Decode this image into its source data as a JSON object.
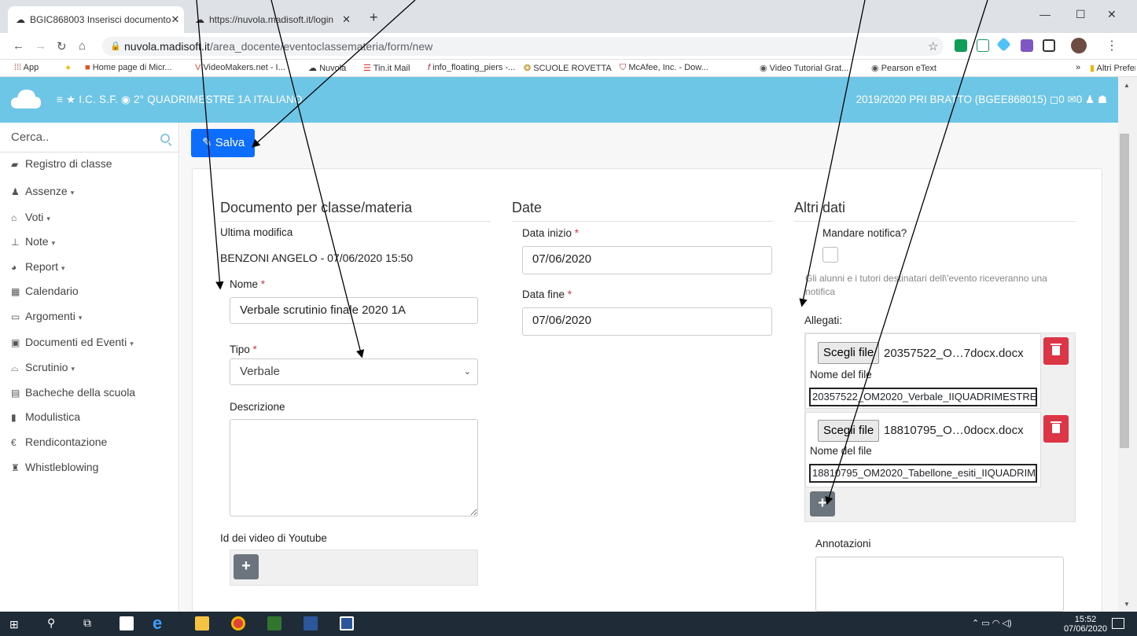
{
  "browser": {
    "tabs": [
      {
        "label": "BGIC868003 Inserisci documento",
        "close": "✕"
      },
      {
        "label": "https://nuvola.madisoft.it/login",
        "close": "✕"
      }
    ],
    "new_tab": "+",
    "window_controls": [
      "—",
      "☐",
      "✕"
    ],
    "url_host": "nuvola.madisoft.it",
    "url_path": "/area_docente/eventoclassemateria/form/new",
    "bookmarks": [
      "App",
      "Home page di Micr...",
      "VideoMakers.net - I...",
      "Nuvola",
      "Tin.it Mail",
      "info_floating_piers -...",
      "SCUOLE ROVETTA",
      "McAfee, Inc. - Dow...",
      "Video Tutorial Grat...",
      "Pearson eText"
    ],
    "bookmarks_more": "»",
    "other_bookmarks": "Altri Preferiti"
  },
  "header": {
    "left": "≡ ★ I.C. S.F. ◉ 2° QUADRIMESTRE  1A  ITALIANO",
    "right": "2019/2020  PRI BRATTO (BGEE868015) ◻0 ✉0 ♟ ☗"
  },
  "sidebar": {
    "search_placeholder": "Cerca..",
    "items": [
      {
        "label": "Registro di classe",
        "caret": ""
      },
      {
        "label": "Assenze",
        "caret": "▾"
      },
      {
        "label": "Voti",
        "caret": "▾"
      },
      {
        "label": "Note",
        "caret": "▾"
      },
      {
        "label": "Report",
        "caret": "▾"
      },
      {
        "label": "Calendario",
        "caret": ""
      },
      {
        "label": "Argomenti",
        "caret": "▾"
      },
      {
        "label": "Documenti ed Eventi",
        "caret": "▾"
      },
      {
        "label": "Scrutinio",
        "caret": "▾"
      },
      {
        "label": "Bacheche della scuola",
        "caret": ""
      },
      {
        "label": "Modulistica",
        "caret": ""
      },
      {
        "label": "Rendicontazione",
        "caret": ""
      },
      {
        "label": "Whistleblowing",
        "caret": ""
      }
    ]
  },
  "toolbar": {
    "save_label": "Salva"
  },
  "form": {
    "col1": {
      "title": "Documento per classe/materia",
      "last_modified_label": "Ultima modifica",
      "last_modified_value": "BENZONI ANGELO - 07/06/2020 15:50",
      "name_label": "Nome",
      "name_value": "Verbale scrutinio finale 2020 1A",
      "type_label": "Tipo",
      "type_value": "Verbale",
      "description_label": "Descrizione",
      "youtube_label": "Id dei video di Youtube"
    },
    "col2": {
      "title": "Date",
      "start_label": "Data inizio",
      "start_value": "07/06/2020",
      "end_label": "Data fine",
      "end_value": "07/06/2020"
    },
    "col3": {
      "title": "Altri dati",
      "notify_label": "Mandare notifica?",
      "notify_help": "Gli alunni e i tutori destinatari dell\\'evento riceveranno una notifica",
      "attachments_label": "Allegati:",
      "attachments": [
        {
          "choose": "Scegli file",
          "chosen": "20357522_O…7docx.docx",
          "filename_label": "Nome del file",
          "filename_value": "20357522_OM2020_Verbale_IIQUADRIMESTRE"
        },
        {
          "choose": "Scegli file",
          "chosen": "18810795_O…0docx.docx",
          "filename_label": "Nome del file",
          "filename_value": "18810795_OM2020_Tabellone_esiti_IIQUADRIM"
        }
      ],
      "notes_label": "Annotazioni"
    },
    "required_mark": "*",
    "add_symbol": "+"
  },
  "taskbar": {
    "time": "15:52",
    "date": "07/06/2020"
  }
}
